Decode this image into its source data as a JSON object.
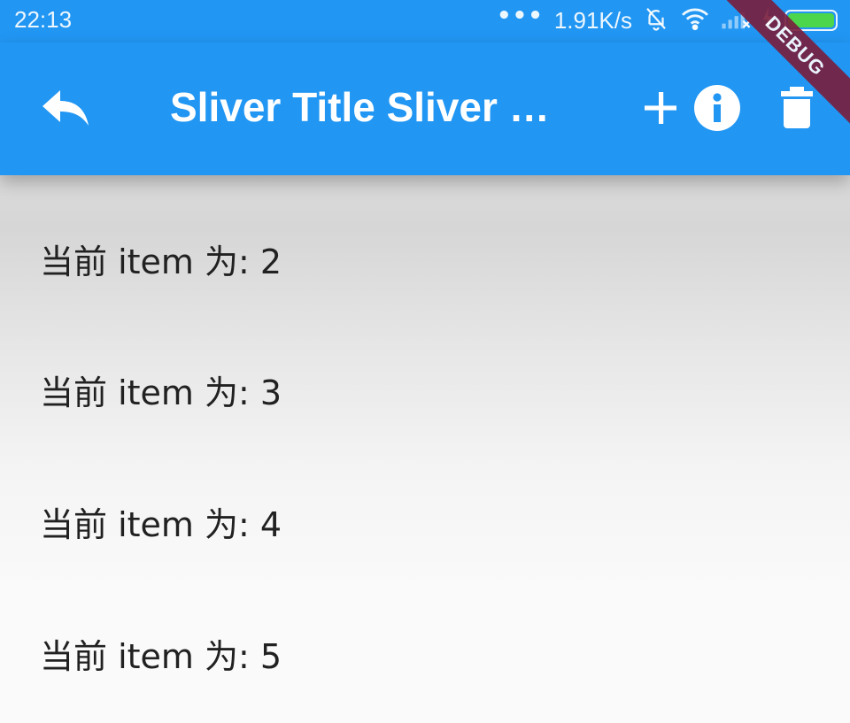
{
  "status_bar": {
    "time": "22:13",
    "dots": "•••",
    "network_speed": "1.91K/s",
    "icons": [
      "bell-off-icon",
      "wifi-icon",
      "signal-icon",
      "charging-icon",
      "battery-icon"
    ],
    "battery_color": "#4cd64c"
  },
  "app_bar": {
    "title": "Sliver Title Sliver Title Sliver Title",
    "background": "#2196f3",
    "actions": [
      "reply-icon",
      "add-icon",
      "info-icon",
      "delete-icon"
    ]
  },
  "debug_banner": {
    "label": "DEBUG"
  },
  "list": {
    "items": [
      {
        "label": "当前 item 为: 2"
      },
      {
        "label": "当前 item 为: 3"
      },
      {
        "label": "当前 item 为: 4"
      },
      {
        "label": "当前 item 为: 5"
      }
    ]
  }
}
